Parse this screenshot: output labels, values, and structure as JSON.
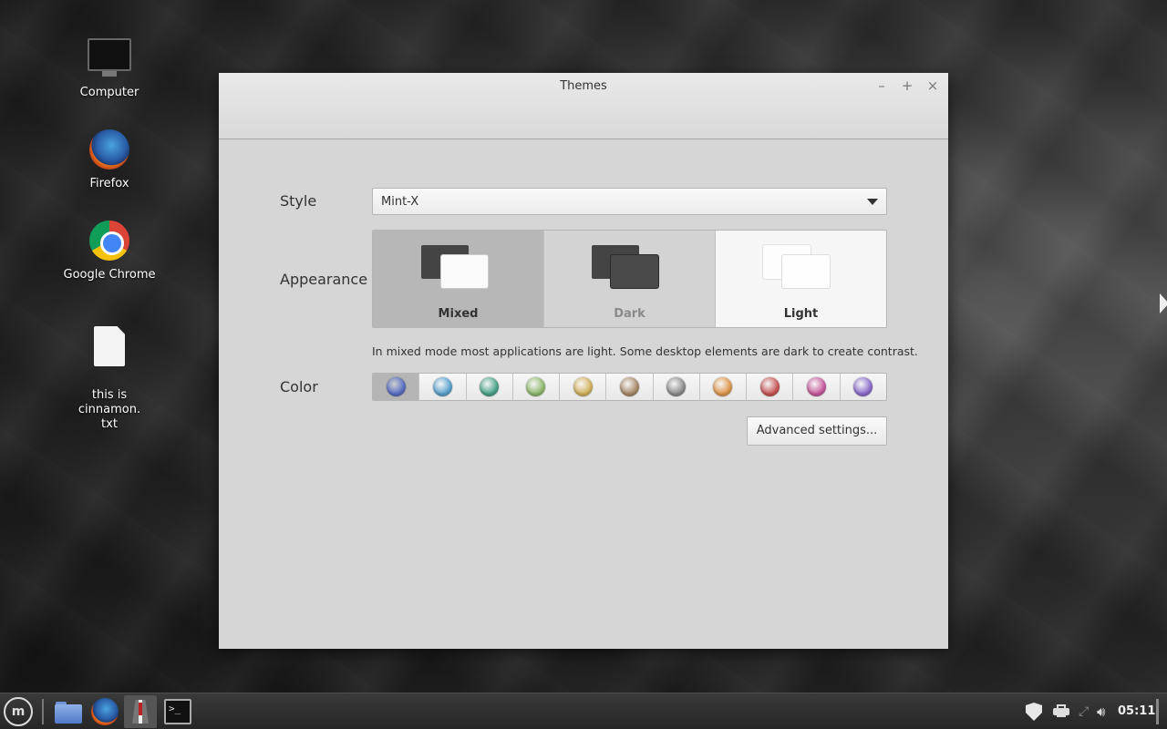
{
  "desktop": {
    "icons": [
      {
        "label": "Computer"
      },
      {
        "label": "Firefox"
      },
      {
        "label": "Google Chrome"
      },
      {
        "label": "this is cinnamon.\ntxt"
      }
    ]
  },
  "window": {
    "title": "Themes",
    "buttons": {
      "minimize": "–",
      "maximize": "+",
      "close": "×"
    }
  },
  "style": {
    "label": "Style",
    "value": "Mint-X"
  },
  "appearance": {
    "label": "Appearance",
    "options": [
      {
        "label": "Mixed",
        "selected": true
      },
      {
        "label": "Dark",
        "selected": false
      },
      {
        "label": "Light",
        "selected": false
      }
    ],
    "description": "In mixed mode most applications are light. Some desktop elements are dark to create contrast."
  },
  "color": {
    "label": "Color",
    "swatches": [
      "#5a70c4",
      "#5ba3cf",
      "#4aa48a",
      "#8fba6e",
      "#d4b35e",
      "#a88a6a",
      "#8d8d8d",
      "#e0994e",
      "#c95656",
      "#c95a9e",
      "#8c6ccc"
    ],
    "selected_index": 0
  },
  "advanced_button": "Advanced settings...",
  "taskbar": {
    "mint_menu_glyph": "m",
    "terminal_glyph": ">_",
    "clock": "05:11"
  }
}
